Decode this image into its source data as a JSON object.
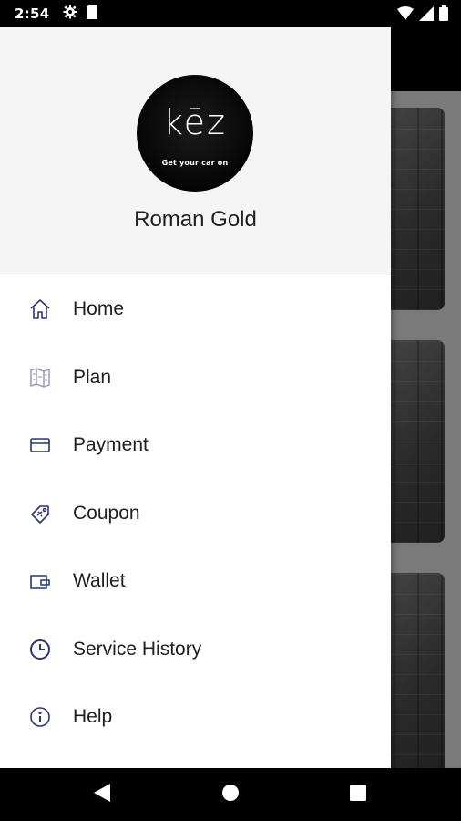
{
  "status_bar": {
    "time": "2:54",
    "icons": [
      "settings-icon",
      "sd-card-icon",
      "wifi-icon",
      "signal-icon",
      "battery-icon"
    ]
  },
  "profile": {
    "logo_text": "kēz",
    "logo_tagline": "Get your car on",
    "name": "Roman Gold"
  },
  "menu": {
    "items": [
      {
        "label": "Home",
        "icon": "home-icon"
      },
      {
        "label": "Plan",
        "icon": "map-icon"
      },
      {
        "label": "Payment",
        "icon": "credit-card-icon"
      },
      {
        "label": "Coupon",
        "icon": "coupon-icon"
      },
      {
        "label": "Wallet",
        "icon": "wallet-icon"
      },
      {
        "label": "Service History",
        "icon": "clock-icon"
      },
      {
        "label": "Help",
        "icon": "info-icon"
      }
    ]
  },
  "colors": {
    "icon_color": "#2a3670",
    "drawer_header_bg": "#f5f5f5",
    "text": "#1f1f1f"
  },
  "nav_bar": {
    "buttons": [
      "back-icon",
      "home-circle-icon",
      "recents-icon"
    ]
  }
}
